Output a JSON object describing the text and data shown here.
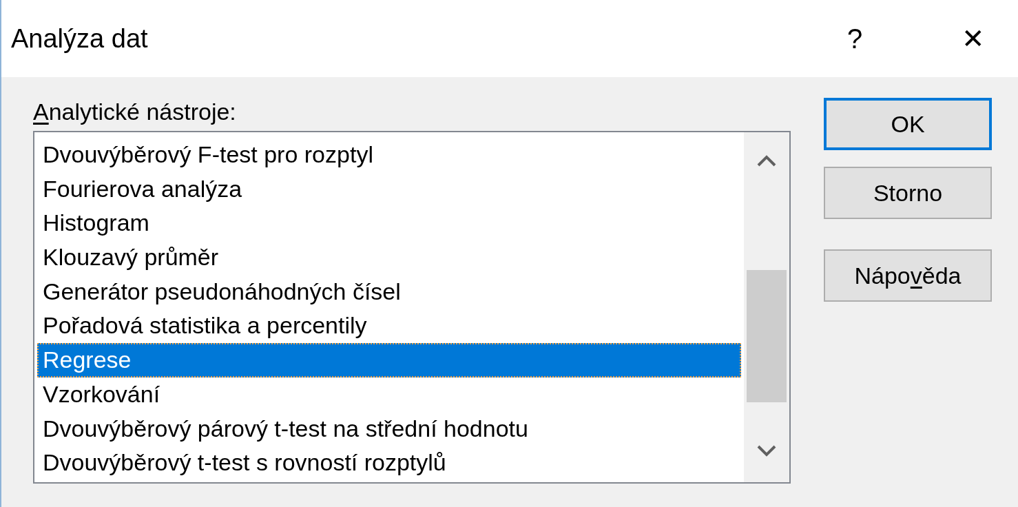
{
  "window": {
    "title": "Analýza dat",
    "help": "?",
    "close": "✕"
  },
  "tools_label": {
    "parts": [
      {
        "text": "A",
        "underlined": true
      },
      {
        "text": "nalytické nástroje:",
        "underlined": false
      }
    ]
  },
  "tools_list": {
    "items": [
      {
        "label": "Dvouvýběrový F-test pro rozptyl",
        "selected": false
      },
      {
        "label": "Fourierova analýza",
        "selected": false
      },
      {
        "label": "Histogram",
        "selected": false
      },
      {
        "label": "Klouzavý průměr",
        "selected": false
      },
      {
        "label": "Generátor pseudonáhodných čísel",
        "selected": false
      },
      {
        "label": "Pořadová statistika a percentily",
        "selected": false
      },
      {
        "label": "Regrese",
        "selected": true
      },
      {
        "label": "Vzorkování",
        "selected": false
      },
      {
        "label": "Dvouvýběrový párový t-test na střední hodnotu",
        "selected": false
      },
      {
        "label": "Dvouvýběrový t-test s rovností rozptylů",
        "selected": false
      }
    ]
  },
  "buttons": [
    {
      "parts": [
        {
          "text": "OK",
          "underlined": false
        }
      ],
      "default": true
    },
    {
      "parts": [
        {
          "text": "Storno",
          "underlined": false
        }
      ],
      "default": false
    },
    {
      "parts": [
        {
          "text": "Nápo",
          "underlined": false
        },
        {
          "text": "v",
          "underlined": true
        },
        {
          "text": "ěda",
          "underlined": false
        }
      ],
      "default": false
    }
  ]
}
